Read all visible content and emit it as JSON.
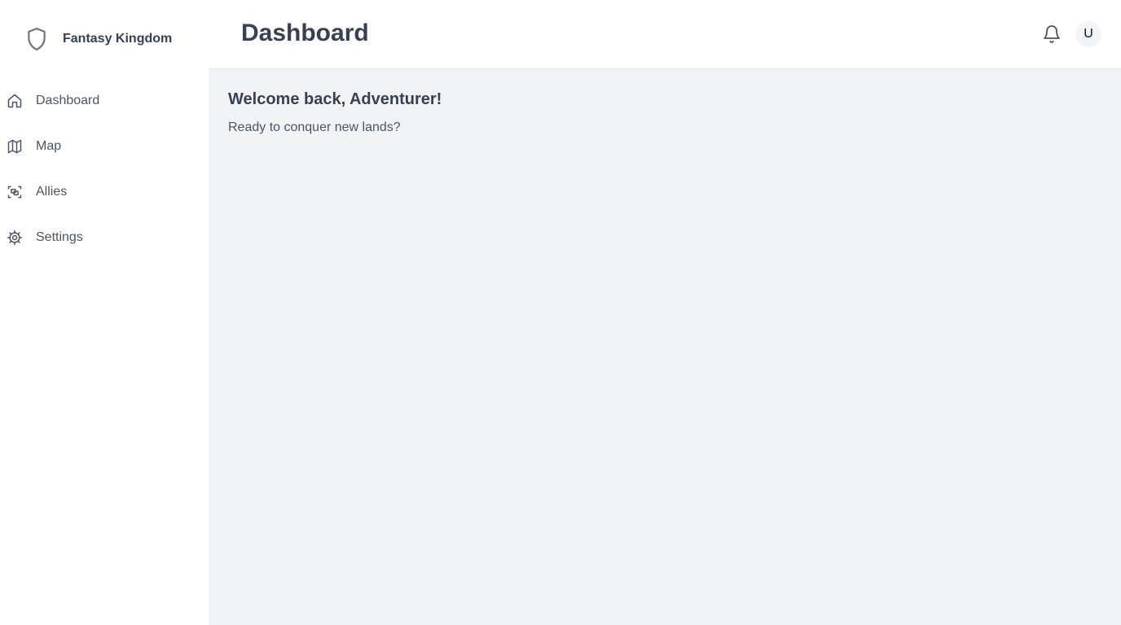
{
  "brand": {
    "name": "Fantasy Kingdom",
    "icon": "shield-icon"
  },
  "sidebar": {
    "items": [
      {
        "label": "Dashboard",
        "icon": "home-icon"
      },
      {
        "label": "Map",
        "icon": "map-icon"
      },
      {
        "label": "Allies",
        "icon": "allies-icon"
      },
      {
        "label": "Settings",
        "icon": "gear-icon"
      }
    ]
  },
  "header": {
    "title": "Dashboard",
    "notifications_icon": "bell-icon",
    "avatar_initial": "U"
  },
  "main": {
    "welcome_title": "Welcome back, Adventurer!",
    "welcome_subtitle": "Ready to conquer new lands?"
  },
  "colors": {
    "text_primary": "#374151",
    "text_secondary": "#4b5563",
    "content_bg": "#f2f3f5",
    "border": "#e5e7eb"
  }
}
